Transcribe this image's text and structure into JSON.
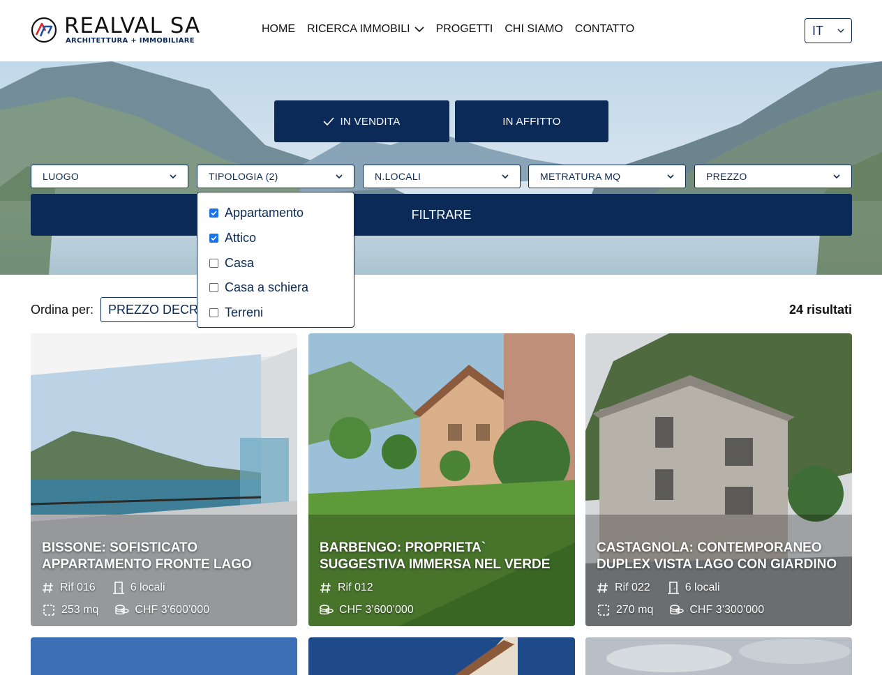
{
  "brand": {
    "name": "REALVAL SA",
    "tagline": "ARCHITETTURA + IMMOBILIARE"
  },
  "nav": {
    "items": [
      {
        "label": "HOME"
      },
      {
        "label": "RICERCA IMMOBILI",
        "icon": "chevron-down-icon"
      },
      {
        "label": "PROGETTI"
      },
      {
        "label": "CHI SIAMO"
      },
      {
        "label": "CONTATTO"
      }
    ]
  },
  "language": {
    "value": "IT"
  },
  "search": {
    "tabs": [
      {
        "label": "IN VENDITA",
        "active": true,
        "icon": "check-icon"
      },
      {
        "label": "IN AFFITTO",
        "active": false
      }
    ],
    "selects": [
      {
        "label": "LUOGO"
      },
      {
        "label": "TIPOLOGIA (2)"
      },
      {
        "label": "N.LOCALI"
      },
      {
        "label": "METRATURA MQ"
      },
      {
        "label": "PREZZO"
      }
    ],
    "filter_label": "FILTRARE",
    "tipologia_options": [
      {
        "label": "Appartamento",
        "checked": true
      },
      {
        "label": "Attico",
        "checked": true
      },
      {
        "label": "Casa",
        "checked": false
      },
      {
        "label": "Casa a schiera",
        "checked": false
      },
      {
        "label": "Terreni",
        "checked": false
      }
    ]
  },
  "sort": {
    "label": "Ordina per:",
    "value": "PREZZO DECRESCENTE"
  },
  "results_count": "24 risultati",
  "listings": [
    {
      "title": "BISSONE: SOFISTICATO APPARTAMENTO FRONTE LAGO",
      "ref": "Rif 016",
      "rooms": "6 locali",
      "area": "253 mq",
      "price": "CHF 3’600’000"
    },
    {
      "title": "BARBENGO: PROPRIETA` SUGGESTIVA IMMERSA NEL VERDE",
      "ref": "Rif 012",
      "price": "CHF 3’600’000"
    },
    {
      "title": "CASTAGNOLA: CONTEMPORANEO DUPLEX VISTA LAGO CON GIARDINO",
      "ref": "Rif 022",
      "rooms": "6 locali",
      "area": "270 mq",
      "price": "CHF 3’300’000"
    }
  ],
  "colors": {
    "primary": "#0b2a57",
    "checkbox": "#1a73e8",
    "logo_red": "#e0242b",
    "logo_blue": "#1d4fa3"
  }
}
